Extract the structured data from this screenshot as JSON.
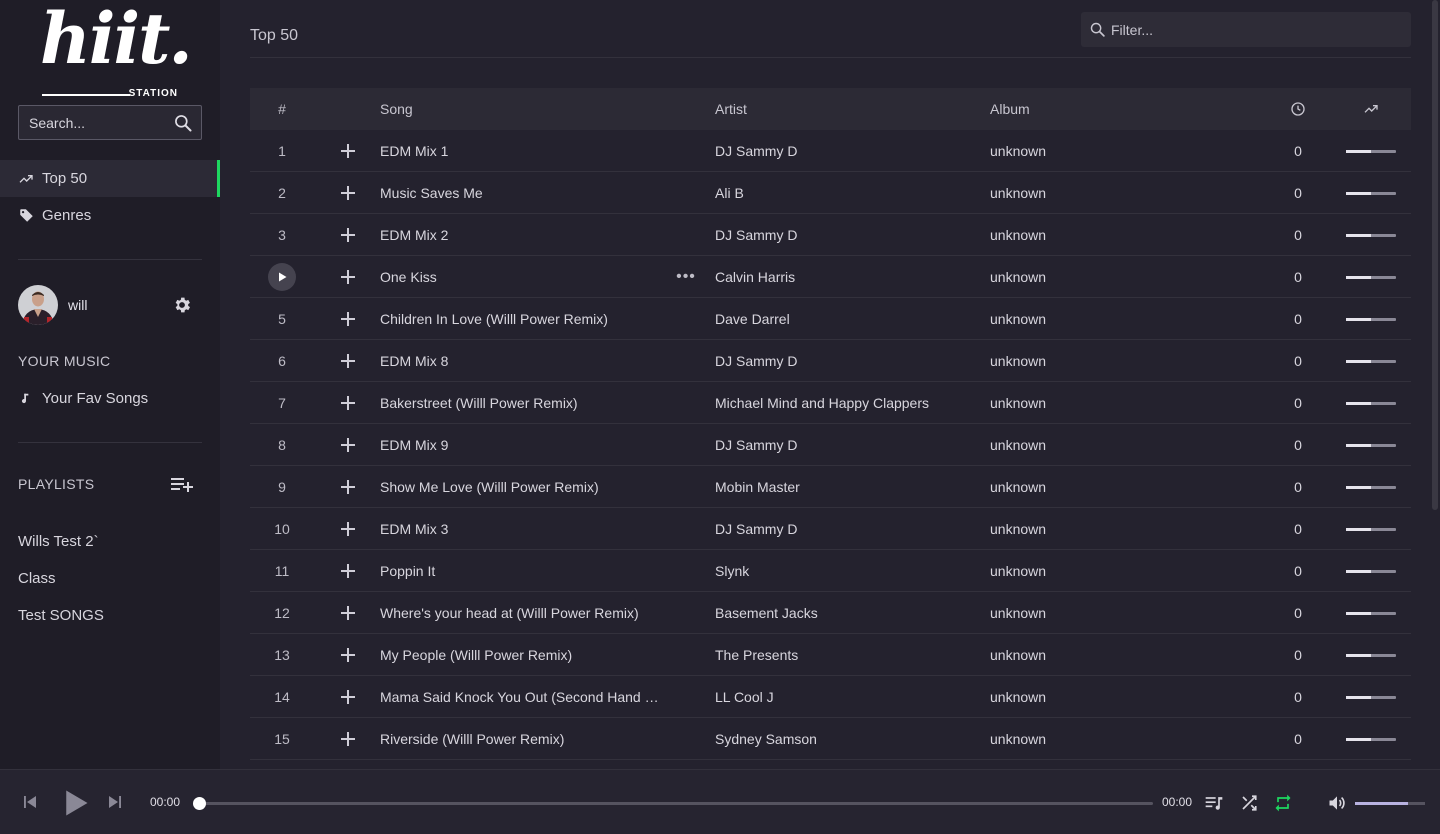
{
  "brand": {
    "logo_word": "hiit.",
    "logo_sub": "STATION"
  },
  "sidebar": {
    "search_placeholder": "Search...",
    "nav": [
      {
        "label": "Top 50",
        "icon": "trending-up-icon",
        "active": true
      },
      {
        "label": "Genres",
        "icon": "tag-icon",
        "active": false
      }
    ],
    "user": {
      "name": "will"
    },
    "your_music_label": "YOUR MUSIC",
    "your_music_items": [
      {
        "label": "Your Fav Songs",
        "icon": "music-note-icon"
      }
    ],
    "playlists_label": "PLAYLISTS",
    "playlists": [
      "Wills Test 2`",
      "Class",
      "Test SONGS"
    ]
  },
  "main": {
    "title": "Top 50",
    "filter_placeholder": "Filter...",
    "columns": {
      "num": "#",
      "song": "Song",
      "artist": "Artist",
      "album": "Album"
    },
    "rows": [
      {
        "num": "1",
        "song": "EDM Mix 1",
        "artist": "DJ Sammy D",
        "album": "unknown",
        "time": "0",
        "trend": 0.5
      },
      {
        "num": "2",
        "song": "Music Saves Me",
        "artist": "Ali B",
        "album": "unknown",
        "time": "0",
        "trend": 0.5
      },
      {
        "num": "3",
        "song": "EDM Mix 2",
        "artist": "DJ Sammy D",
        "album": "unknown",
        "time": "0",
        "trend": 0.5
      },
      {
        "num": "",
        "song": "One Kiss",
        "artist": "Calvin Harris",
        "album": "unknown",
        "time": "0",
        "trend": 0.5,
        "hover": true
      },
      {
        "num": "5",
        "song": "Children In Love (Willl Power Remix)",
        "artist": "Dave Darrel",
        "album": "unknown",
        "time": "0",
        "trend": 0.5
      },
      {
        "num": "6",
        "song": "EDM Mix 8",
        "artist": "DJ Sammy D",
        "album": "unknown",
        "time": "0",
        "trend": 0.5
      },
      {
        "num": "7",
        "song": "Bakerstreet (Willl Power Remix)",
        "artist": "Michael Mind and Happy Clappers",
        "album": "unknown",
        "time": "0",
        "trend": 0.5
      },
      {
        "num": "8",
        "song": "EDM Mix 9",
        "artist": "DJ Sammy D",
        "album": "unknown",
        "time": "0",
        "trend": 0.5
      },
      {
        "num": "9",
        "song": "Show Me Love (Willl Power Remix)",
        "artist": "Mobin Master",
        "album": "unknown",
        "time": "0",
        "trend": 0.5
      },
      {
        "num": "10",
        "song": "EDM Mix 3",
        "artist": "DJ Sammy D",
        "album": "unknown",
        "time": "0",
        "trend": 0.5
      },
      {
        "num": "11",
        "song": "Poppin It",
        "artist": "Slynk",
        "album": "unknown",
        "time": "0",
        "trend": 0.5
      },
      {
        "num": "12",
        "song": "Where's your head at (Willl Power Remix)",
        "artist": "Basement Jacks",
        "album": "unknown",
        "time": "0",
        "trend": 0.5
      },
      {
        "num": "13",
        "song": "My People (Willl Power Remix)",
        "artist": "The Presents",
        "album": "unknown",
        "time": "0",
        "trend": 0.5
      },
      {
        "num": "14",
        "song": "Mama Said Knock You Out (Second Hand …",
        "artist": "LL Cool J",
        "album": "unknown",
        "time": "0",
        "trend": 0.5
      },
      {
        "num": "15",
        "song": "Riverside (Willl Power Remix)",
        "artist": "Sydney Samson",
        "album": "unknown",
        "time": "0",
        "trend": 0.5
      }
    ]
  },
  "player": {
    "elapsed": "00:00",
    "duration": "00:00",
    "progress": 0,
    "volume": 0.75,
    "repeat_active": true
  },
  "colors": {
    "accent": "#1ed760",
    "background": "#24222e",
    "sidebar": "#1f1d27"
  }
}
